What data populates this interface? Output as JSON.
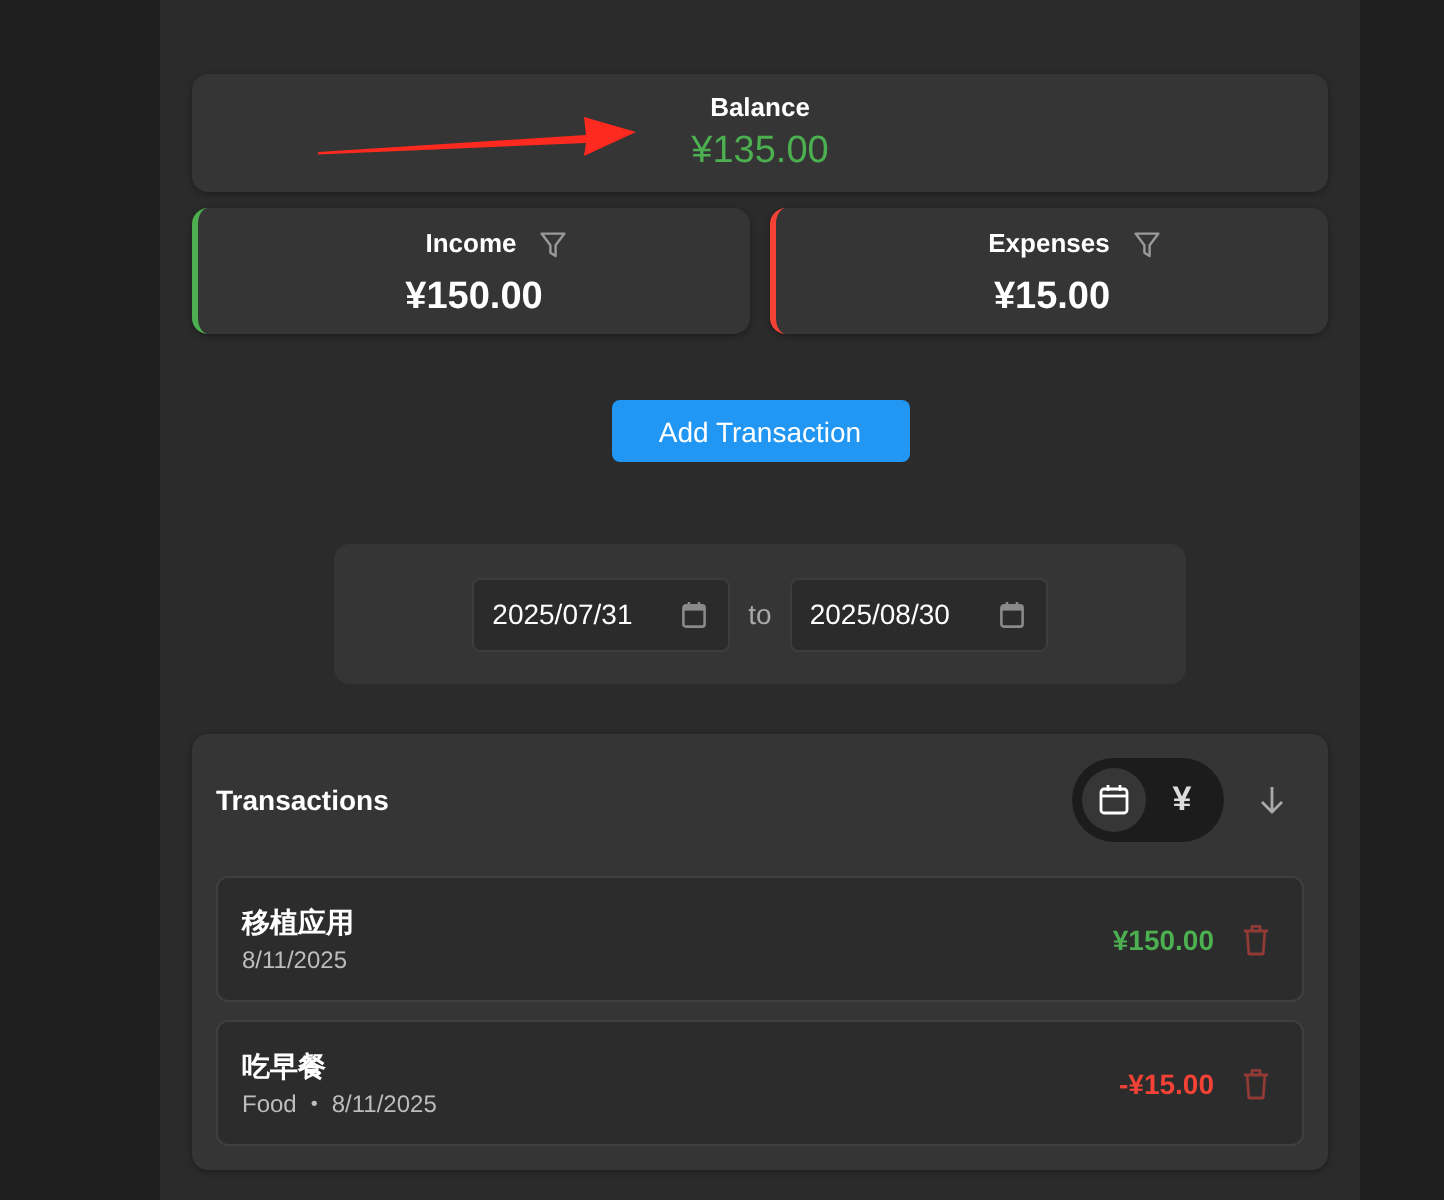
{
  "balance": {
    "label": "Balance",
    "amount": "¥135.00"
  },
  "annotation": {
    "kind": "arrow"
  },
  "summary": [
    {
      "kind": "income",
      "label": "Income",
      "amount": "¥150.00"
    },
    {
      "kind": "expense",
      "label": "Expenses",
      "amount": "¥15.00"
    }
  ],
  "add_button": {
    "label": "Add Transaction"
  },
  "date_range": {
    "from": "2025/07/31",
    "separator": "to",
    "to": "2025/08/30"
  },
  "transactions": {
    "title": "Transactions",
    "sort_options": [
      {
        "kind": "date",
        "selected": true
      },
      {
        "kind": "amount",
        "label": "¥",
        "selected": false
      }
    ],
    "sort_descending": true,
    "items": [
      {
        "kind": "income",
        "title": "移植应用",
        "date": "8/11/2025",
        "amount": "¥150.00"
      },
      {
        "kind": "expense",
        "title": "吃早餐",
        "category": "Food",
        "separator": "•",
        "date": "8/11/2025",
        "amount": "-¥15.00"
      }
    ]
  }
}
